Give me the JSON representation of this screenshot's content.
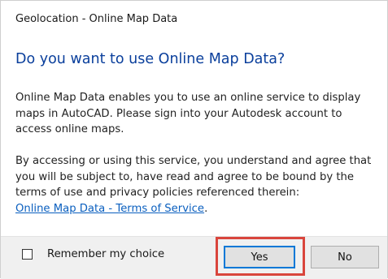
{
  "window": {
    "title": "Geolocation - Online Map Data"
  },
  "dialog": {
    "heading": "Do you want to use Online Map Data?",
    "paragraph1": "Online Map Data enables you to use an online service to display maps in AutoCAD. Please sign into your Autodesk account to access online maps.",
    "paragraph2": "By accessing or using this service, you understand and agree that you will be subject to, have read and agree to be bound by the terms of use and privacy policies referenced therein:",
    "link": "Online Map Data - Terms of Service",
    "link_suffix": "."
  },
  "footer": {
    "checkbox_label": "Remember my choice",
    "checkbox_checked": false,
    "yes_label": "Yes",
    "no_label": "No"
  },
  "colors": {
    "heading": "#0a3f9c",
    "link": "#0a5fbf",
    "highlight": "#d9453c",
    "default_button_border": "#0078d7"
  }
}
